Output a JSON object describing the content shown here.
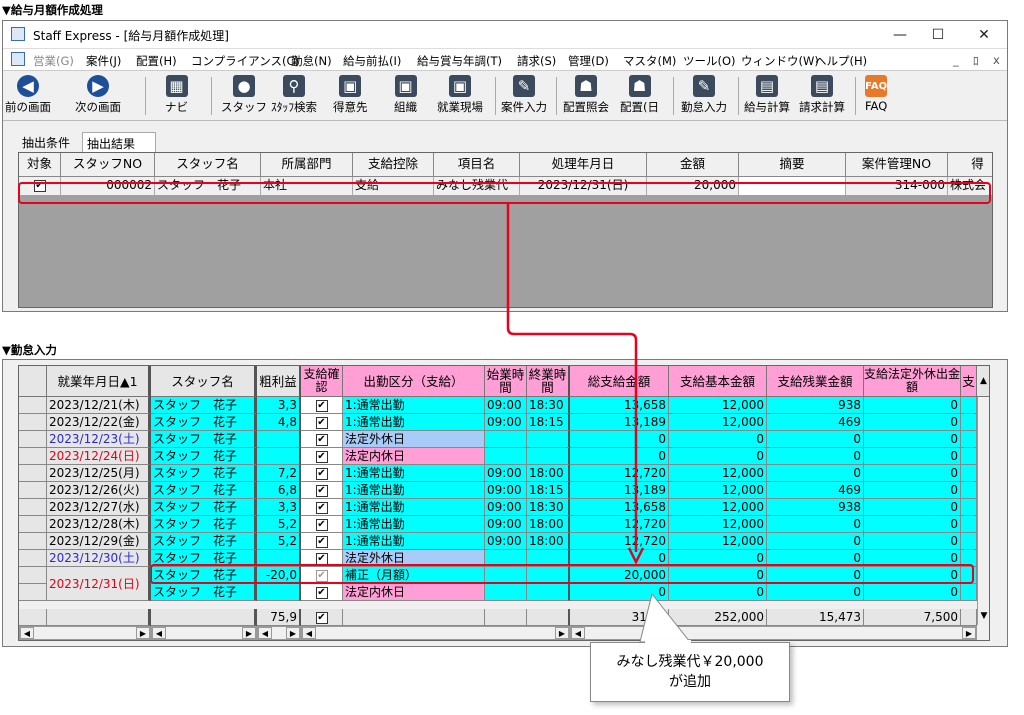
{
  "section1_title": "▼給与月額作成処理",
  "window_title": "Staff Express - [給与月額作成処理]",
  "win_buttons": [
    "—",
    "☐",
    "✕"
  ],
  "mdi_buttons": [
    "_",
    "ﾛ",
    "x"
  ],
  "menu": [
    "営業(G)",
    "案件(J)",
    "配置(H)",
    "コンプライアンス(C)",
    "勤怠(N)",
    "給与前払(I)",
    "給与賞与年調(T)",
    "請求(S)",
    "管理(D)",
    "マスタ(M)",
    "ツール(O)",
    "ウィンドウ(W)",
    "ヘルプ(H)"
  ],
  "toolbar": [
    "前の画面",
    "次の画面",
    "ナビ",
    "スタッフ",
    "ｽﾀｯﾌ検索",
    "得意先",
    "組織",
    "就業現場",
    "案件入力",
    "配置照会",
    "配置(日",
    "勤怠入力",
    "給与計算",
    "請求計算",
    "FAQ"
  ],
  "tabs": [
    "抽出条件",
    "抽出結果"
  ],
  "grid1": {
    "headers": [
      "対象",
      "スタッフNO",
      "スタッフ名",
      "所属部門",
      "支給控除",
      "項目名",
      "処理年月日",
      "金額",
      "摘要",
      "案件管理NO",
      "得"
    ],
    "row": {
      "check": "✔",
      "staff_no": "000002",
      "name": "スタッフ　花子",
      "dept": "本社",
      "type": "支給",
      "item": "みなし残業代",
      "date": "2023/12/31(日)",
      "amount": "20,000",
      "memo": "",
      "case_no": "314-000",
      "client": "株式会"
    }
  },
  "section2_title": "▼勤怠入力",
  "grid2": {
    "headers": [
      "就業年月日▲1",
      "スタッフ名",
      "粗利益",
      "支給確認",
      "出勤区分（支給）",
      "始業時間",
      "終業時間",
      "総支給金額",
      "支給基本金額",
      "支給残業金額",
      "支給法定外休出金額",
      "支"
    ],
    "rows": [
      {
        "date": "2023/12/21(木)",
        "name": "スタッフ　花子",
        "gross": "3,3",
        "kubun": "1:通常出勤",
        "start": "09:00",
        "end": "18:30",
        "total": "13,658",
        "base": "12,000",
        "ot": "938",
        "hol": "0"
      },
      {
        "date": "2023/12/22(金)",
        "name": "スタッフ　花子",
        "gross": "4,8",
        "kubun": "1:通常出勤",
        "start": "09:00",
        "end": "18:15",
        "total": "13,189",
        "base": "12,000",
        "ot": "469",
        "hol": "0"
      },
      {
        "date": "2023/12/23(土)",
        "name": "スタッフ　花子",
        "gross": "",
        "kubun": "法定外休日",
        "start": "",
        "end": "",
        "total": "0",
        "base": "0",
        "ot": "0",
        "hol": "0"
      },
      {
        "date": "2023/12/24(日)",
        "name": "スタッフ　花子",
        "gross": "",
        "kubun": "法定内休日",
        "start": "",
        "end": "",
        "total": "0",
        "base": "0",
        "ot": "0",
        "hol": "0"
      },
      {
        "date": "2023/12/25(月)",
        "name": "スタッフ　花子",
        "gross": "7,2",
        "kubun": "1:通常出勤",
        "start": "09:00",
        "end": "18:00",
        "total": "12,720",
        "base": "12,000",
        "ot": "0",
        "hol": "0"
      },
      {
        "date": "2023/12/26(火)",
        "name": "スタッフ　花子",
        "gross": "6,8",
        "kubun": "1:通常出勤",
        "start": "09:00",
        "end": "18:15",
        "total": "13,189",
        "base": "12,000",
        "ot": "469",
        "hol": "0"
      },
      {
        "date": "2023/12/27(水)",
        "name": "スタッフ　花子",
        "gross": "3,3",
        "kubun": "1:通常出勤",
        "start": "09:00",
        "end": "18:30",
        "total": "13,658",
        "base": "12,000",
        "ot": "938",
        "hol": "0"
      },
      {
        "date": "2023/12/28(木)",
        "name": "スタッフ　花子",
        "gross": "5,2",
        "kubun": "1:通常出勤",
        "start": "09:00",
        "end": "18:00",
        "total": "12,720",
        "base": "12,000",
        "ot": "0",
        "hol": "0"
      },
      {
        "date": "2023/12/29(金)",
        "name": "スタッフ　花子",
        "gross": "5,2",
        "kubun": "1:通常出勤",
        "start": "09:00",
        "end": "18:00",
        "total": "12,720",
        "base": "12,000",
        "ot": "0",
        "hol": "0"
      },
      {
        "date": "2023/12/30(土)",
        "name": "スタッフ　花子",
        "gross": "",
        "kubun": "法定外休日",
        "start": "",
        "end": "",
        "total": "0",
        "base": "0",
        "ot": "0",
        "hol": "0"
      },
      {
        "date": "2023/12/31(日)",
        "name": "スタッフ　花子",
        "gross": "-20,0",
        "kubun": "補正（月額）",
        "start": "",
        "end": "",
        "total": "20,000",
        "base": "0",
        "ot": "0",
        "hol": "0"
      },
      {
        "date": "",
        "name": "スタッフ　花子",
        "gross": "",
        "kubun": "法定内休日",
        "start": "",
        "end": "",
        "total": "0",
        "base": "0",
        "ot": "0",
        "hol": "0"
      }
    ],
    "totals": {
      "gross": "75,9",
      "total": "310,0",
      "base": "252,000",
      "ot": "15,473",
      "hol": "7,500"
    }
  },
  "callout": {
    "line1": "みなし残業代￥20,000",
    "line2": "が追加"
  },
  "colors": {
    "cyan": "#00ffff",
    "pink": "#ff9fd6",
    "blue": "#a8ccf8",
    "highlight": "#e8001c",
    "sat_text": "#2a2ad0",
    "sun_text": "#e0001a"
  }
}
